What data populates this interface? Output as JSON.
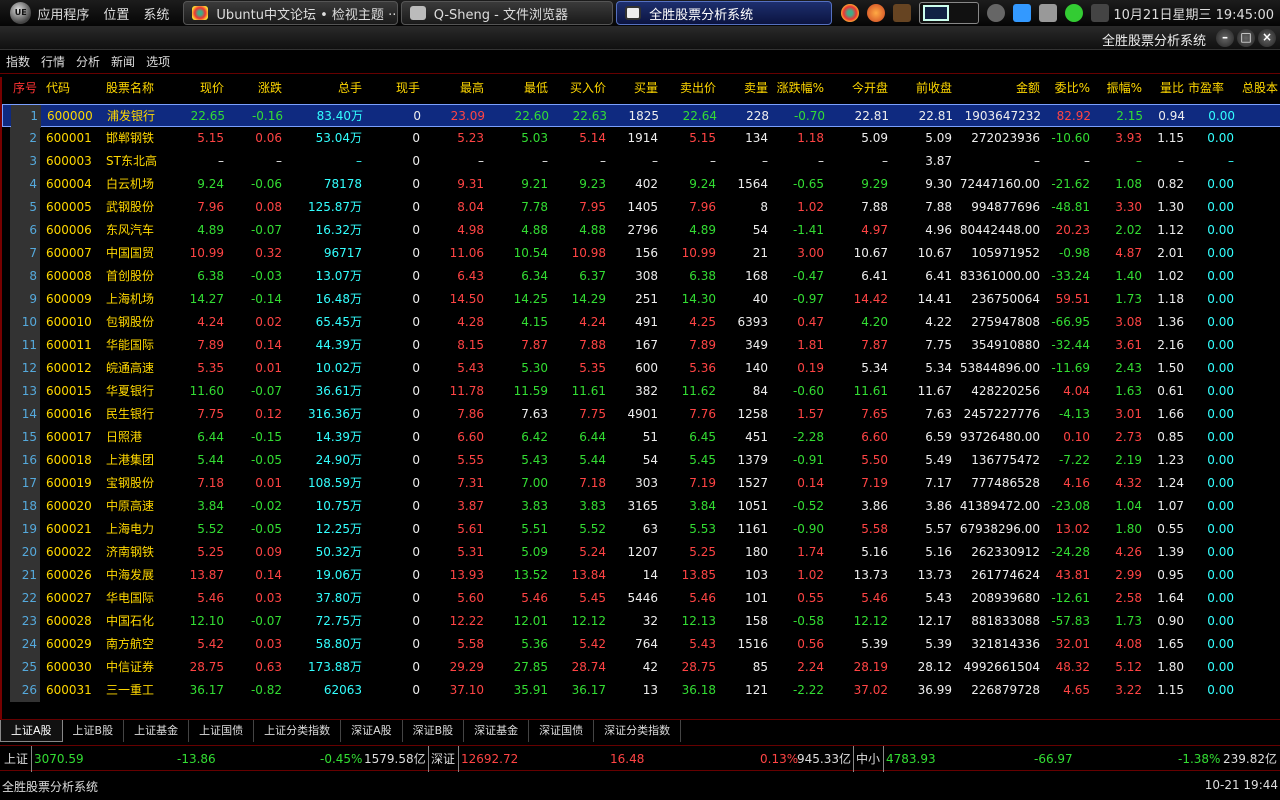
{
  "panel": {
    "menus": [
      "应用程序",
      "位置",
      "系统"
    ],
    "tasks": [
      {
        "label": "Ubuntu中文论坛 • 检视主题 ···",
        "active": false
      },
      {
        "label": "Q-Sheng - 文件浏览器",
        "active": false
      },
      {
        "label": "全胜股票分析系统",
        "active": true
      }
    ],
    "clock": "10月21日星期三 19:45:00"
  },
  "window": {
    "title": "全胜股票分析系统"
  },
  "menubar": [
    "指数",
    "行情",
    "分析",
    "新闻",
    "选项"
  ],
  "table": {
    "columns": [
      "序号",
      "代码",
      "股票名称",
      "现价",
      "涨跌",
      "总手",
      "现手",
      "最高",
      "最低",
      "买入价",
      "买量",
      "卖出价",
      "卖量",
      "涨跌幅%",
      "今开盘",
      "前收盘",
      "金额",
      "委比%",
      "振幅%",
      "量比",
      "市盈率",
      "总股本"
    ],
    "rows": [
      [
        "1",
        "600000",
        "浦发银行",
        "22.65",
        "-0.16",
        "83.40万",
        "0",
        "23.09",
        "22.60",
        "22.63",
        "1825",
        "22.64",
        "228",
        "-0.70",
        "22.81",
        "22.81",
        "1903647232",
        "82.92",
        "2.15",
        "0.94",
        "0.00"
      ],
      [
        "2",
        "600001",
        "邯郸钢铁",
        "5.15",
        "0.06",
        "53.04万",
        "0",
        "5.23",
        "5.03",
        "5.14",
        "1914",
        "5.15",
        "134",
        "1.18",
        "5.09",
        "5.09",
        "272023936",
        "-10.60",
        "3.93",
        "1.15",
        "0.00"
      ],
      [
        "3",
        "600003",
        "ST东北高",
        "–",
        "–",
        "–",
        "0",
        "–",
        "–",
        "–",
        "–",
        "–",
        "–",
        "–",
        "–",
        "3.87",
        "–",
        "–",
        "–",
        "–",
        "–"
      ],
      [
        "4",
        "600004",
        "白云机场",
        "9.24",
        "-0.06",
        "78178",
        "0",
        "9.31",
        "9.21",
        "9.23",
        "402",
        "9.24",
        "1564",
        "-0.65",
        "9.29",
        "9.30",
        "72447160.00",
        "-21.62",
        "1.08",
        "0.82",
        "0.00"
      ],
      [
        "5",
        "600005",
        "武钢股份",
        "7.96",
        "0.08",
        "125.87万",
        "0",
        "8.04",
        "7.78",
        "7.95",
        "1405",
        "7.96",
        "8",
        "1.02",
        "7.88",
        "7.88",
        "994877696",
        "-48.81",
        "3.30",
        "1.30",
        "0.00"
      ],
      [
        "6",
        "600006",
        "东风汽车",
        "4.89",
        "-0.07",
        "16.32万",
        "0",
        "4.98",
        "4.88",
        "4.88",
        "2796",
        "4.89",
        "54",
        "-1.41",
        "4.97",
        "4.96",
        "80442448.00",
        "20.23",
        "2.02",
        "1.12",
        "0.00"
      ],
      [
        "7",
        "600007",
        "中国国贸",
        "10.99",
        "0.32",
        "96717",
        "0",
        "11.06",
        "10.54",
        "10.98",
        "156",
        "10.99",
        "21",
        "3.00",
        "10.67",
        "10.67",
        "105971952",
        "-0.98",
        "4.87",
        "2.01",
        "0.00"
      ],
      [
        "8",
        "600008",
        "首创股份",
        "6.38",
        "-0.03",
        "13.07万",
        "0",
        "6.43",
        "6.34",
        "6.37",
        "308",
        "6.38",
        "168",
        "-0.47",
        "6.41",
        "6.41",
        "83361000.00",
        "-33.24",
        "1.40",
        "1.02",
        "0.00"
      ],
      [
        "9",
        "600009",
        "上海机场",
        "14.27",
        "-0.14",
        "16.48万",
        "0",
        "14.50",
        "14.25",
        "14.29",
        "251",
        "14.30",
        "40",
        "-0.97",
        "14.42",
        "14.41",
        "236750064",
        "59.51",
        "1.73",
        "1.18",
        "0.00"
      ],
      [
        "10",
        "600010",
        "包钢股份",
        "4.24",
        "0.02",
        "65.45万",
        "0",
        "4.28",
        "4.15",
        "4.24",
        "491",
        "4.25",
        "6393",
        "0.47",
        "4.20",
        "4.22",
        "275947808",
        "-66.95",
        "3.08",
        "1.36",
        "0.00"
      ],
      [
        "11",
        "600011",
        "华能国际",
        "7.89",
        "0.14",
        "44.39万",
        "0",
        "8.15",
        "7.87",
        "7.88",
        "167",
        "7.89",
        "349",
        "1.81",
        "7.87",
        "7.75",
        "354910880",
        "-32.44",
        "3.61",
        "2.16",
        "0.00"
      ],
      [
        "12",
        "600012",
        "皖通高速",
        "5.35",
        "0.01",
        "10.02万",
        "0",
        "5.43",
        "5.30",
        "5.35",
        "600",
        "5.36",
        "140",
        "0.19",
        "5.34",
        "5.34",
        "53844896.00",
        "-11.69",
        "2.43",
        "1.50",
        "0.00"
      ],
      [
        "13",
        "600015",
        "华夏银行",
        "11.60",
        "-0.07",
        "36.61万",
        "0",
        "11.78",
        "11.59",
        "11.61",
        "382",
        "11.62",
        "84",
        "-0.60",
        "11.61",
        "11.67",
        "428220256",
        "4.04",
        "1.63",
        "0.61",
        "0.00"
      ],
      [
        "14",
        "600016",
        "民生银行",
        "7.75",
        "0.12",
        "316.36万",
        "0",
        "7.86",
        "7.63",
        "7.75",
        "4901",
        "7.76",
        "1258",
        "1.57",
        "7.65",
        "7.63",
        "2457227776",
        "-4.13",
        "3.01",
        "1.66",
        "0.00"
      ],
      [
        "15",
        "600017",
        "日照港",
        "6.44",
        "-0.15",
        "14.39万",
        "0",
        "6.60",
        "6.42",
        "6.44",
        "51",
        "6.45",
        "451",
        "-2.28",
        "6.60",
        "6.59",
        "93726480.00",
        "0.10",
        "2.73",
        "0.85",
        "0.00"
      ],
      [
        "16",
        "600018",
        "上港集团",
        "5.44",
        "-0.05",
        "24.90万",
        "0",
        "5.55",
        "5.43",
        "5.44",
        "54",
        "5.45",
        "1379",
        "-0.91",
        "5.50",
        "5.49",
        "136775472",
        "-7.22",
        "2.19",
        "1.23",
        "0.00"
      ],
      [
        "17",
        "600019",
        "宝钢股份",
        "7.18",
        "0.01",
        "108.59万",
        "0",
        "7.31",
        "7.00",
        "7.18",
        "303",
        "7.19",
        "1527",
        "0.14",
        "7.19",
        "7.17",
        "777486528",
        "4.16",
        "4.32",
        "1.24",
        "0.00"
      ],
      [
        "18",
        "600020",
        "中原高速",
        "3.84",
        "-0.02",
        "10.75万",
        "0",
        "3.87",
        "3.83",
        "3.83",
        "3165",
        "3.84",
        "1051",
        "-0.52",
        "3.86",
        "3.86",
        "41389472.00",
        "-23.08",
        "1.04",
        "1.07",
        "0.00"
      ],
      [
        "19",
        "600021",
        "上海电力",
        "5.52",
        "-0.05",
        "12.25万",
        "0",
        "5.61",
        "5.51",
        "5.52",
        "63",
        "5.53",
        "1161",
        "-0.90",
        "5.58",
        "5.57",
        "67938296.00",
        "13.02",
        "1.80",
        "0.55",
        "0.00"
      ],
      [
        "20",
        "600022",
        "济南钢铁",
        "5.25",
        "0.09",
        "50.32万",
        "0",
        "5.31",
        "5.09",
        "5.24",
        "1207",
        "5.25",
        "180",
        "1.74",
        "5.16",
        "5.16",
        "262330912",
        "-24.28",
        "4.26",
        "1.39",
        "0.00"
      ],
      [
        "21",
        "600026",
        "中海发展",
        "13.87",
        "0.14",
        "19.06万",
        "0",
        "13.93",
        "13.52",
        "13.84",
        "14",
        "13.85",
        "103",
        "1.02",
        "13.73",
        "13.73",
        "261774624",
        "43.81",
        "2.99",
        "0.95",
        "0.00"
      ],
      [
        "22",
        "600027",
        "华电国际",
        "5.46",
        "0.03",
        "37.80万",
        "0",
        "5.60",
        "5.46",
        "5.45",
        "5446",
        "5.46",
        "101",
        "0.55",
        "5.46",
        "5.43",
        "208939680",
        "-12.61",
        "2.58",
        "1.64",
        "0.00"
      ],
      [
        "23",
        "600028",
        "中国石化",
        "12.10",
        "-0.07",
        "72.75万",
        "0",
        "12.22",
        "12.01",
        "12.12",
        "32",
        "12.13",
        "158",
        "-0.58",
        "12.12",
        "12.17",
        "881833088",
        "-57.83",
        "1.73",
        "0.90",
        "0.00"
      ],
      [
        "24",
        "600029",
        "南方航空",
        "5.42",
        "0.03",
        "58.80万",
        "0",
        "5.58",
        "5.36",
        "5.42",
        "764",
        "5.43",
        "1516",
        "0.56",
        "5.39",
        "5.39",
        "321814336",
        "32.01",
        "4.08",
        "1.65",
        "0.00"
      ],
      [
        "25",
        "600030",
        "中信证券",
        "28.75",
        "0.63",
        "173.88万",
        "0",
        "29.29",
        "27.85",
        "28.74",
        "42",
        "28.75",
        "85",
        "2.24",
        "28.19",
        "28.12",
        "4992661504",
        "48.32",
        "5.12",
        "1.80",
        "0.00"
      ],
      [
        "26",
        "600031",
        "三一重工",
        "36.17",
        "-0.82",
        "62063",
        "0",
        "37.10",
        "35.91",
        "36.17",
        "13",
        "36.18",
        "121",
        "-2.22",
        "37.02",
        "36.99",
        "226879728",
        "4.65",
        "3.22",
        "1.15",
        "0.00"
      ]
    ]
  },
  "tabs": [
    "上证A股",
    "上证B股",
    "上证基金",
    "上证国债",
    "上证分类指数",
    "深证A股",
    "深证B股",
    "深证基金",
    "深证国债",
    "深证分类指数"
  ],
  "index_bar": {
    "sh": {
      "label": "上证",
      "value": "3070.59",
      "change": "-13.86",
      "pct": "-0.45%",
      "amount": "1579.58亿"
    },
    "sz": {
      "label": "深证",
      "value": "12692.72",
      "change": "16.48",
      "pct": "0.13%",
      "amount": "945.33亿"
    },
    "zx": {
      "label": "中小",
      "value": "4783.93",
      "change": "-66.97",
      "pct": "-1.38%",
      "amount": "239.82亿"
    }
  },
  "status": {
    "left": "全胜股票分析系统",
    "right": "10-21 19:44"
  },
  "colors": {
    "up": "#ff4444",
    "down": "#33dd33",
    "neutral": "#eeeeee",
    "code": "#ffd800",
    "name": "#ffd800",
    "volume": "#33ffff",
    "header": "#ffd800",
    "header_first": "#ff3333"
  }
}
